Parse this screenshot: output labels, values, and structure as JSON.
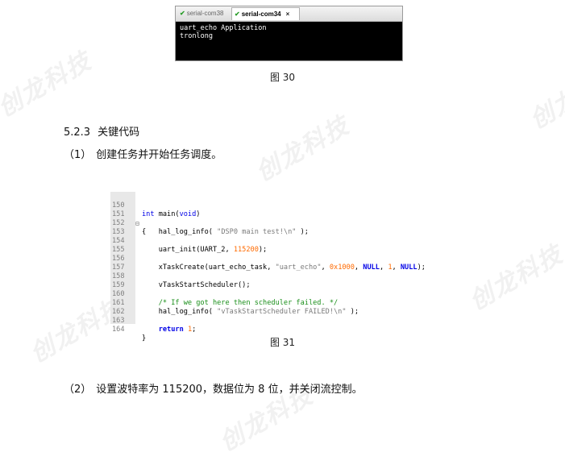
{
  "terminal": {
    "tabs": [
      {
        "label": "serial-com38",
        "icon": "check-icon",
        "active": false
      },
      {
        "label": "serial-com34",
        "icon": "check-icon",
        "active": true,
        "close": "×"
      }
    ],
    "output": [
      "uart_echo Application",
      "tronlong"
    ]
  },
  "caption_30": "图 30",
  "section": {
    "number": "5.2.3",
    "title": "关键代码"
  },
  "step1": {
    "num": "（1）",
    "text": "创建任务并开始任务调度。"
  },
  "code": {
    "line_numbers": [
      "150",
      "151",
      "152",
      "153",
      "154",
      "155",
      "156",
      "157",
      "158",
      "159",
      "160",
      "161",
      "162",
      "163",
      "164"
    ],
    "l150": {
      "kw1": "int",
      "name": " main(",
      "kw2": "void",
      "end": ")"
    },
    "l151": "{",
    "l152": {
      "fn": "    hal_log_info( ",
      "str": "\"DSP0 main test!\\n\"",
      "end": " );"
    },
    "l154": {
      "fn": "    uart_init(UART_2, ",
      "num": "115200",
      "end": ");"
    },
    "l156": {
      "fn": "    xTaskCreate(uart_echo_task, ",
      "str": "\"uart_echo\"",
      "c1": ", ",
      "num1": "0x1000",
      "c2": ", ",
      "null1": "NULL",
      "c3": ", ",
      "num2": "1",
      "c4": ", ",
      "null2": "NULL",
      "end": ");"
    },
    "l158": "    vTaskStartScheduler();",
    "l160": "    /* If we got here then scheduler failed. */",
    "l161": {
      "fn": "    hal_log_info( ",
      "str": "\"vTaskStartScheduler FAILED!\\n\"",
      "end": " );"
    },
    "l163": {
      "kw": "    return",
      "sp": " ",
      "num": "1",
      "end": ";"
    },
    "l164": "}",
    "fold_marker": "⊟"
  },
  "caption_31": "图 31",
  "step2": {
    "num": "（2）",
    "text": "设置波特率为 115200，数据位为 8 位，并关闭流控制。"
  },
  "watermark": "创龙科技",
  "colors": {
    "keyword": "#0000e6",
    "string": "#7a7a7a",
    "number": "#ff6a00",
    "comment": "#1a8f1a"
  }
}
